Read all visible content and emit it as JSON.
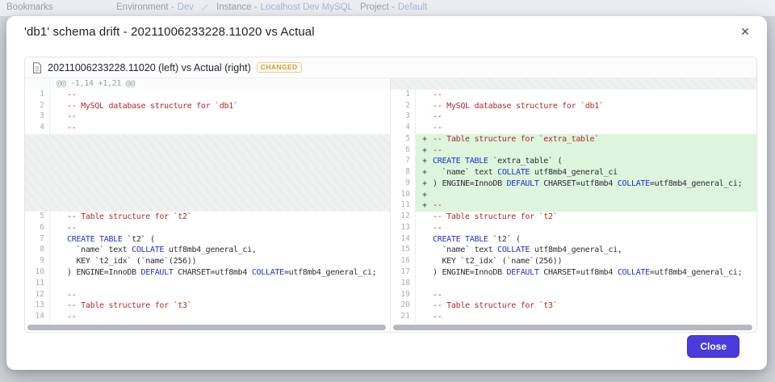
{
  "topbar": {
    "bookmarks": "Bookmarks",
    "environment_label": "Environment -",
    "environment_value": "Dev",
    "instance_label": "Instance -",
    "instance_value": "Localhost Dev MySQL",
    "project_label": "Project -",
    "project_value": "Default"
  },
  "modal": {
    "title": "'db1' schema drift - 20211006233228.11020 vs Actual",
    "close_icon": "✕",
    "close_button_label": "Close"
  },
  "diff": {
    "file_label": "20211006233228.11020 (left) vs Actual (right)",
    "badge": "CHANGED",
    "hunk_header": "@@ -1,14 +1,21 @@",
    "left": [
      {
        "n": "",
        "t": "hunk",
        "seg": [
          [
            "hk",
            "@@ -1,14 +1,21 @@"
          ]
        ]
      },
      {
        "n": "1",
        "t": "ctx",
        "seg": [
          [
            "cm",
            "--"
          ]
        ]
      },
      {
        "n": "2",
        "t": "ctx",
        "seg": [
          [
            "cm",
            "-- MySQL database structure for `db1`"
          ]
        ]
      },
      {
        "n": "3",
        "t": "ctx",
        "seg": [
          [
            "cm",
            "--"
          ]
        ]
      },
      {
        "n": "4",
        "t": "ctx",
        "seg": [
          [
            "cm",
            "--"
          ]
        ]
      },
      {
        "n": "",
        "t": "ph",
        "seg": []
      },
      {
        "n": "",
        "t": "ph",
        "seg": []
      },
      {
        "n": "",
        "t": "ph",
        "seg": []
      },
      {
        "n": "",
        "t": "ph",
        "seg": []
      },
      {
        "n": "",
        "t": "ph",
        "seg": []
      },
      {
        "n": "",
        "t": "ph",
        "seg": []
      },
      {
        "n": "",
        "t": "ph",
        "seg": []
      },
      {
        "n": "5",
        "t": "ctx",
        "seg": [
          [
            "cm",
            "-- Table structure for `t2`"
          ]
        ]
      },
      {
        "n": "6",
        "t": "ctx",
        "seg": [
          [
            "cm",
            "--"
          ]
        ]
      },
      {
        "n": "7",
        "t": "ctx",
        "seg": [
          [
            "kw",
            "CREATE TABLE"
          ],
          [
            "tx",
            " `t2` ("
          ]
        ]
      },
      {
        "n": "8",
        "t": "ctx",
        "seg": [
          [
            "tx",
            "  `name` text "
          ],
          [
            "kw",
            "COLLATE"
          ],
          [
            "tx",
            " utf8mb4_general_ci,"
          ]
        ]
      },
      {
        "n": "9",
        "t": "ctx",
        "seg": [
          [
            "tx",
            "  KEY `t2_idx` (`name`(256))"
          ]
        ]
      },
      {
        "n": "10",
        "t": "ctx",
        "seg": [
          [
            "tx",
            ") ENGINE=InnoDB "
          ],
          [
            "kw",
            "DEFAULT"
          ],
          [
            "tx",
            " CHARSET=utf8mb4 "
          ],
          [
            "kw",
            "COLLATE"
          ],
          [
            "tx",
            "=utf8mb4_general_ci;"
          ]
        ]
      },
      {
        "n": "11",
        "t": "ctx",
        "seg": []
      },
      {
        "n": "12",
        "t": "ctx",
        "seg": [
          [
            "cm",
            "--"
          ]
        ]
      },
      {
        "n": "13",
        "t": "ctx",
        "seg": [
          [
            "cm",
            "-- Table structure for `t3`"
          ]
        ]
      },
      {
        "n": "14",
        "t": "ctx",
        "seg": [
          [
            "cm",
            "--"
          ]
        ]
      }
    ],
    "right": [
      {
        "n": "",
        "t": "ph",
        "seg": []
      },
      {
        "n": "1",
        "t": "ctx",
        "seg": [
          [
            "cm",
            "--"
          ]
        ]
      },
      {
        "n": "2",
        "t": "ctx",
        "seg": [
          [
            "cm",
            "-- MySQL database structure for `db1`"
          ]
        ]
      },
      {
        "n": "3",
        "t": "ctx",
        "seg": [
          [
            "cm",
            "--"
          ]
        ]
      },
      {
        "n": "4",
        "t": "ctx",
        "seg": [
          [
            "cm",
            "--"
          ]
        ]
      },
      {
        "n": "5",
        "t": "add",
        "seg": [
          [
            "cm",
            "-- Table structure for `extra_table`"
          ]
        ]
      },
      {
        "n": "6",
        "t": "add",
        "seg": [
          [
            "cm",
            "--"
          ]
        ]
      },
      {
        "n": "7",
        "t": "add",
        "seg": [
          [
            "kw",
            "CREATE TABLE"
          ],
          [
            "tx",
            " `extra_table` ("
          ]
        ]
      },
      {
        "n": "8",
        "t": "add",
        "seg": [
          [
            "tx",
            "  `name` text "
          ],
          [
            "kw",
            "COLLATE"
          ],
          [
            "tx",
            " utf8mb4_general_ci"
          ]
        ]
      },
      {
        "n": "9",
        "t": "add",
        "seg": [
          [
            "tx",
            ") ENGINE=InnoDB "
          ],
          [
            "kw",
            "DEFAULT"
          ],
          [
            "tx",
            " CHARSET=utf8mb4 "
          ],
          [
            "kw",
            "COLLATE"
          ],
          [
            "tx",
            "=utf8mb4_general_ci;"
          ]
        ]
      },
      {
        "n": "10",
        "t": "add",
        "seg": []
      },
      {
        "n": "11",
        "t": "add",
        "seg": [
          [
            "cm",
            "--"
          ]
        ]
      },
      {
        "n": "12",
        "t": "ctx",
        "seg": [
          [
            "cm",
            "-- Table structure for `t2`"
          ]
        ]
      },
      {
        "n": "13",
        "t": "ctx",
        "seg": [
          [
            "cm",
            "--"
          ]
        ]
      },
      {
        "n": "14",
        "t": "ctx",
        "seg": [
          [
            "kw",
            "CREATE TABLE"
          ],
          [
            "tx",
            " `t2` ("
          ]
        ]
      },
      {
        "n": "15",
        "t": "ctx",
        "seg": [
          [
            "tx",
            "  `name` text "
          ],
          [
            "kw",
            "COLLATE"
          ],
          [
            "tx",
            " utf8mb4_general_ci,"
          ]
        ]
      },
      {
        "n": "16",
        "t": "ctx",
        "seg": [
          [
            "tx",
            "  KEY `t2_idx` (`name`(256))"
          ]
        ]
      },
      {
        "n": "17",
        "t": "ctx",
        "seg": [
          [
            "tx",
            ") ENGINE=InnoDB "
          ],
          [
            "kw",
            "DEFAULT"
          ],
          [
            "tx",
            " CHARSET=utf8mb4 "
          ],
          [
            "kw",
            "COLLATE"
          ],
          [
            "tx",
            "=utf8mb4_general_ci;"
          ]
        ]
      },
      {
        "n": "18",
        "t": "ctx",
        "seg": []
      },
      {
        "n": "19",
        "t": "ctx",
        "seg": [
          [
            "cm",
            "--"
          ]
        ]
      },
      {
        "n": "20",
        "t": "ctx",
        "seg": [
          [
            "cm",
            "-- Table structure for `t3`"
          ]
        ]
      },
      {
        "n": "21",
        "t": "ctx",
        "seg": [
          [
            "cm",
            "--"
          ]
        ]
      }
    ]
  },
  "colors": {
    "accent_button": "#4c3bdb",
    "added_line_bg": "#dcf5dc",
    "comment": "#b02a2a",
    "keyword": "#2130cc",
    "badge_text": "#c9a23e"
  }
}
